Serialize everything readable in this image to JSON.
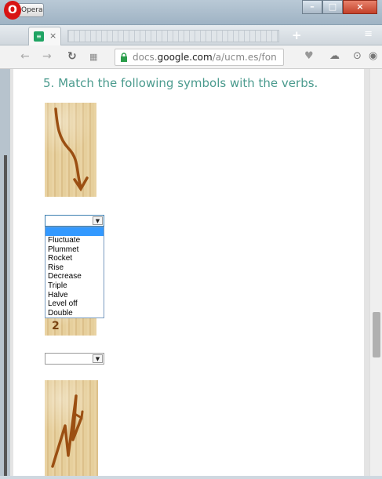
{
  "window": {
    "app_name": "Opera",
    "controls": {
      "minimize": "–",
      "maximize": "□",
      "close": "×"
    }
  },
  "tabs": {
    "close_glyph": "×",
    "add_glyph": "+",
    "menu_glyph": "≡"
  },
  "address_bar": {
    "url_prefix": "docs.",
    "url_domain": "google.com",
    "url_rest": "/a/ucm.es/fon"
  },
  "question": {
    "title": "5. Match the following symbols with the verbs.",
    "image2_number": "2"
  },
  "dropdown_open": {
    "selected": "",
    "options": [
      "Fluctuate",
      "Plummet",
      "Rocket",
      "Rise",
      "Decrease",
      "Triple",
      "Halve",
      "Level off",
      "Double"
    ]
  },
  "dropdown_closed": {
    "selected": ""
  },
  "colors": {
    "title": "#4b9b8e",
    "arrow": "#9b4f12",
    "papyrus": "#e3c994",
    "highlight": "#3399ff"
  }
}
